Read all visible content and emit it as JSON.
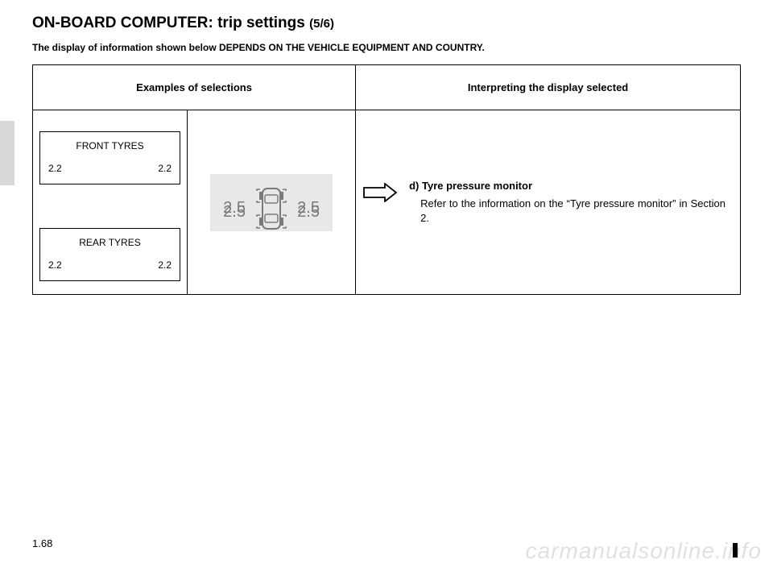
{
  "heading": {
    "title_prefix": "ON-BOARD COMPUTER: ",
    "title_main": "trip settings",
    "page_indicator": "(5/6)"
  },
  "subheading": "The display of information shown below DEPENDS ON THE VEHICLE EQUIPMENT AND COUNTRY.",
  "table": {
    "header_left": "Examples of selections",
    "header_right": "Interpreting the display selected"
  },
  "front_tyres": {
    "label": "FRONT TYRES",
    "left": "2.2",
    "right": "2.2"
  },
  "rear_tyres": {
    "label": "REAR TYRES",
    "left": "2.2",
    "right": "2.2"
  },
  "car_display": {
    "fl": "2.5",
    "fr": "2.5",
    "rl": "2.5",
    "rr": "2.5"
  },
  "interpretation": {
    "title": "d) Tyre pressure monitor",
    "body": "Refer to the information on the “Tyre pressure monitor” in Section 2."
  },
  "page_number": "1.68",
  "watermark": "carmanualsonline.info"
}
